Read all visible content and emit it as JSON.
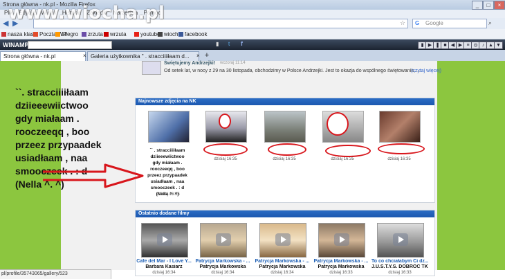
{
  "browser": {
    "window_title": "Strona główna - nk.pl - Mozilla Firefox",
    "menu": [
      "Plik",
      "Edycja",
      "Widok",
      "Historia",
      "Zakładki",
      "Narzędzia",
      "Pomoc"
    ],
    "search_placeholder": "Google",
    "bookmarks": [
      {
        "label": "nasza klasa",
        "color": "#cc3333"
      },
      {
        "label": "Poczta WP",
        "color": "#e34b2a"
      },
      {
        "label": "allegro",
        "color": "#ff9900"
      },
      {
        "label": "zrzuta",
        "color": "#6b4ea8"
      },
      {
        "label": "wrzuta",
        "color": "#cc0000"
      },
      {
        "label": "youtube",
        "color": "#e62117"
      },
      {
        "label": "wiocha",
        "color": "#444444"
      },
      {
        "label": "facebook",
        "color": "#3b5998"
      }
    ],
    "winamp_label": "WINAMP",
    "tabs": [
      {
        "label": "Strona główna - nk.pl"
      },
      {
        "label": "Galeria użytkownika \" . stracciiiiłaam d..."
      }
    ],
    "status_url": "pl/profile/35743065/gallery/523"
  },
  "watermark": "www.wiocha.pl",
  "annotation_caption": "``. stracciiiiłaam\ndziieeewiictwoo\ngdy miałaam .\nrooczeeqq , boo\nprzeez przypaadek\nusiadłaam , naa\nsmooczeek . : d\n(Nella ^. ^)",
  "news": {
    "title": "Świętujemy Andrzejki!",
    "time": "wczoraj 11:14",
    "text": "Od setek lat, w nocy z 29 na 30 listopada, obchodzimy w Polsce Andrzejki. Jest to okazja do wspólnego świętowania, ...",
    "more": "(czytaj więcej)"
  },
  "photos_section": {
    "header": "Najnowsze zdjęcia na NK",
    "first_caption": "`` . stracciiiiłaam\ndziieeewiictwoo\ngdy miałaam .\nrooczeeqq , boo\nprzeez przypaadek\nusiadłaam , naa\nsmooczeek . : d\n(Nella ^. ^)",
    "items": [
      {
        "time": "dzisiaj 16:35"
      },
      {
        "time": "dzisiaj 16:35"
      },
      {
        "time": "dzisiaj 16:35"
      },
      {
        "time": "dzisiaj 16:35"
      },
      {
        "time": "dzisiaj 16:35"
      }
    ]
  },
  "films_section": {
    "header": "Ostatnio dodane filmy",
    "items": [
      {
        "title": "Cafe del Mar - I Love Y...",
        "author": "Barbara Kasiarz",
        "time": "dzisiaj 16:34"
      },
      {
        "title": "Patrycja Markowska - ...",
        "author": "Patrycja Markowska",
        "time": "dzisiaj 16:34"
      },
      {
        "title": "Patrycja Markowska - ...",
        "author": "Patrycja Markowska",
        "time": "dzisiaj 16:34"
      },
      {
        "title": "Patrycja Markowska - ...",
        "author": "Patrycja Markowska",
        "time": "dzisiaj 16:33"
      },
      {
        "title": "To co chciałabym Ci dz...",
        "author": "J.U.S.T.Y.S. DOBROĆ TKWI...",
        "time": "dzisiaj 16:33"
      }
    ]
  },
  "colors": {
    "page_green": "#8cc63f",
    "section_header_blue": "#1c58b0",
    "annotation_red": "#d8161c"
  }
}
